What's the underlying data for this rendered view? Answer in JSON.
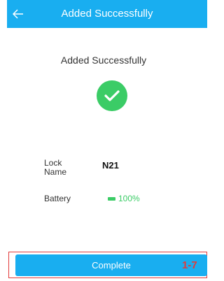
{
  "header": {
    "title": "Added Successfully",
    "back_icon": "arrow-left-icon"
  },
  "main": {
    "message": "Added Successfully",
    "status_icon": "check-circle-icon"
  },
  "details": {
    "lock_name_label": "Lock Name",
    "lock_name_value": "N21",
    "battery_label": "Battery",
    "battery_value": "100%",
    "battery_icon": "battery-icon"
  },
  "footer": {
    "complete_label": "Complete",
    "annotation": "1-7"
  },
  "colors": {
    "accent": "#19aef0",
    "success": "#3bcc66",
    "annotation": "#e23b3b"
  }
}
